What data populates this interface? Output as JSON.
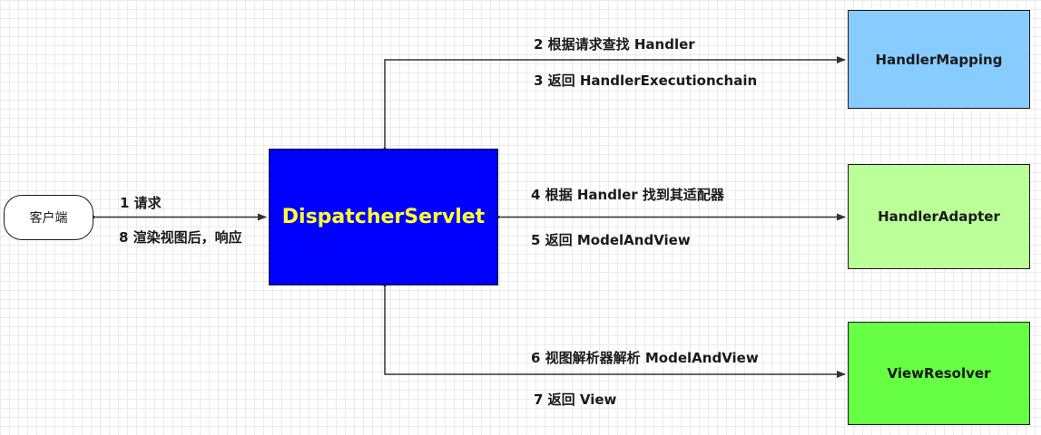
{
  "nodes": {
    "client": "客户端",
    "dispatcher": "DispatcherServlet",
    "mapping": "HandlerMapping",
    "adapter": "HandlerAdapter",
    "resolver": "ViewResolver"
  },
  "edges": {
    "e1": "1 请求",
    "e2": "2 根据请求查找 Handler",
    "e3": "3 返回 HandlerExecutionchain",
    "e4": "4 根据 Handler 找到其适配器",
    "e5": "5 返回 ModelAndView",
    "e6": "6 视图解析器解析 ModelAndView",
    "e7": "7 返回 View",
    "e8": "8 渲染视图后，响应"
  },
  "colors": {
    "dispatcher_fill": "#0000ff",
    "dispatcher_text": "#ffff33",
    "mapping_fill": "#88ccff",
    "adapter_fill": "#bbff99",
    "resolver_fill": "#66ff44",
    "line": "#333333"
  }
}
